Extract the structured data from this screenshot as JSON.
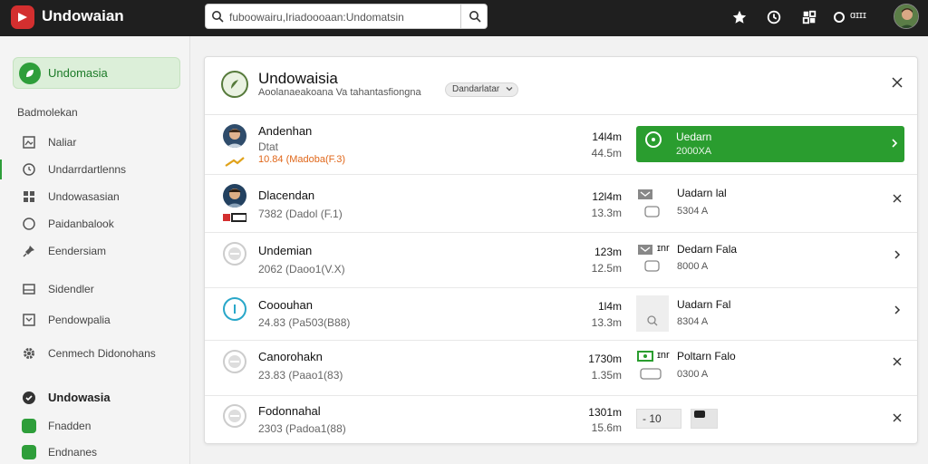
{
  "colors": {
    "accent": "#2a9d2f",
    "brand": "#d32f2f",
    "topbar": "#1f1f1f",
    "warn": "#e0671a"
  },
  "topbar": {
    "app_title": "Undowaian",
    "search_value": "fuboowairu,Iriadoooaan:Undomatsin",
    "label": "ɑɪɪɪ",
    "icons": [
      "star-icon",
      "clock-icon",
      "grid-icon",
      "circle-icon"
    ]
  },
  "sidebar": {
    "active_label": "Undomasia",
    "heading": "Badmolekan",
    "items": [
      {
        "label": "Naliar",
        "icon": "image-icon"
      },
      {
        "label": "Undarrdartlenns",
        "icon": "clock-icon"
      },
      {
        "label": "Undowasasian",
        "icon": "grid-icon"
      },
      {
        "label": "Paidanbalook",
        "icon": "circle-icon"
      },
      {
        "label": "Eendersiam",
        "icon": "pin-icon"
      },
      {
        "label": "Sidendler",
        "icon": "tray-icon"
      },
      {
        "label": "Pendowpalia",
        "icon": "message-icon"
      },
      {
        "label": "Cenmech Didonohans",
        "icon": "gear-icon"
      }
    ],
    "section_label": "Undowasia",
    "section_items": [
      "Fnadden",
      "Endnanes"
    ]
  },
  "panel": {
    "title": "Undowaisia",
    "subtitle": "Aoolanaeakoana Va tahantasfiongna",
    "dropdown": "Dandarlatar",
    "rows": [
      {
        "name": "Andenhan",
        "sub": "Dtat",
        "tag": "10.84 (Madoba(F.3)",
        "val1": "14l4m",
        "val2": "44.5m",
        "action_title": "Uedarn",
        "action_sub": "2000XA"
      },
      {
        "name": "Dlacendan",
        "sub": "7382 (Dadol (F.1)",
        "val1": "12l4m",
        "val2": "13.3m",
        "action_title": "Uadarn lal",
        "action_sub": "5304 A"
      },
      {
        "name": "Undemian",
        "sub": "2062 (Daoo1(V.X)",
        "val1": "123m",
        "val2": "12.5m",
        "action_title": "Dedarn Fala",
        "action_sub": "8000 A",
        "action_prefix": "ɪnr"
      },
      {
        "name": "Cooouhan",
        "sub": "24.83 (Pa503(B88)",
        "val1": "1l4m",
        "val2": "13.3m",
        "action_title": "Uadarn Fal",
        "action_sub": "8304 A"
      },
      {
        "name": "Canorohakn",
        "sub": "23.83 (Paao1(83)",
        "val1": "1730m",
        "val2": "1.35m",
        "action_title": "Poltarn Falo",
        "action_sub": "0300 A",
        "action_prefix": "ɪnr"
      },
      {
        "name": "Fodonnahal",
        "sub": "2303 (Padoa1(88)",
        "val1": "1301m",
        "val2": "15.6m",
        "step_value": "- 10"
      }
    ]
  }
}
